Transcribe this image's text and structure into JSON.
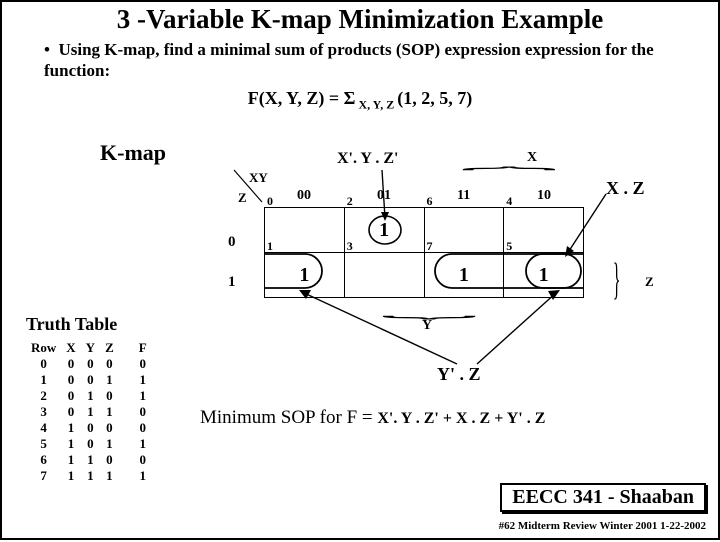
{
  "title": "3 -Variable K-map Minimization Example",
  "bullet": "Using K-map,  find a minimal sum of products (SOP) expression expression for the function:",
  "formula_fn": "F(X, Y, Z) = ",
  "formula_sigma": "Σ",
  "formula_sub": " X, Y, Z ",
  "formula_terms": "(1, 2, 5, 7)",
  "kmap_label": "K-map",
  "xy": "XY",
  "z": "Z",
  "term_xyz": "X'. Y . Z'",
  "x_label": "X",
  "xz_label": "X . Z",
  "z_side": "Z",
  "col_hdrs": [
    "00",
    "01",
    "11",
    "10"
  ],
  "row_hdrs": [
    "0",
    "1"
  ],
  "cells": [
    {
      "idx": "0",
      "val": ""
    },
    {
      "idx": "2",
      "val": ""
    },
    {
      "idx": "6",
      "val": ""
    },
    {
      "idx": "4",
      "val": ""
    },
    {
      "idx": "1",
      "val": "1"
    },
    {
      "idx": "3",
      "val": ""
    },
    {
      "idx": "7",
      "val": "1"
    },
    {
      "idx": "5",
      "val": "1"
    }
  ],
  "circle_val": "1",
  "y_label": "Y",
  "yz_label": "Y' . Z",
  "tt_title": "Truth Table",
  "tt_headers": [
    "Row",
    "X",
    "Y",
    "Z",
    "F"
  ],
  "tt_rows": [
    [
      "0",
      "0",
      "0",
      "0",
      "0"
    ],
    [
      "1",
      "0",
      "0",
      "1",
      "1"
    ],
    [
      "2",
      "0",
      "1",
      "0",
      "1"
    ],
    [
      "3",
      "0",
      "1",
      "1",
      "0"
    ],
    [
      "4",
      "1",
      "0",
      "0",
      "0"
    ],
    [
      "5",
      "1",
      "0",
      "1",
      "1"
    ],
    [
      "6",
      "1",
      "1",
      "0",
      "0"
    ],
    [
      "7",
      "1",
      "1",
      "1",
      "1"
    ]
  ],
  "minsop_label": "Minimum SOP for  F  =  ",
  "minsop_expr": "X'. Y . Z' +  X . Z  +  Y' . Z",
  "footer1": "EECC 341 - Shaaban",
  "footer2": "#62   Midterm Review   Winter 2001  1-22-2002"
}
